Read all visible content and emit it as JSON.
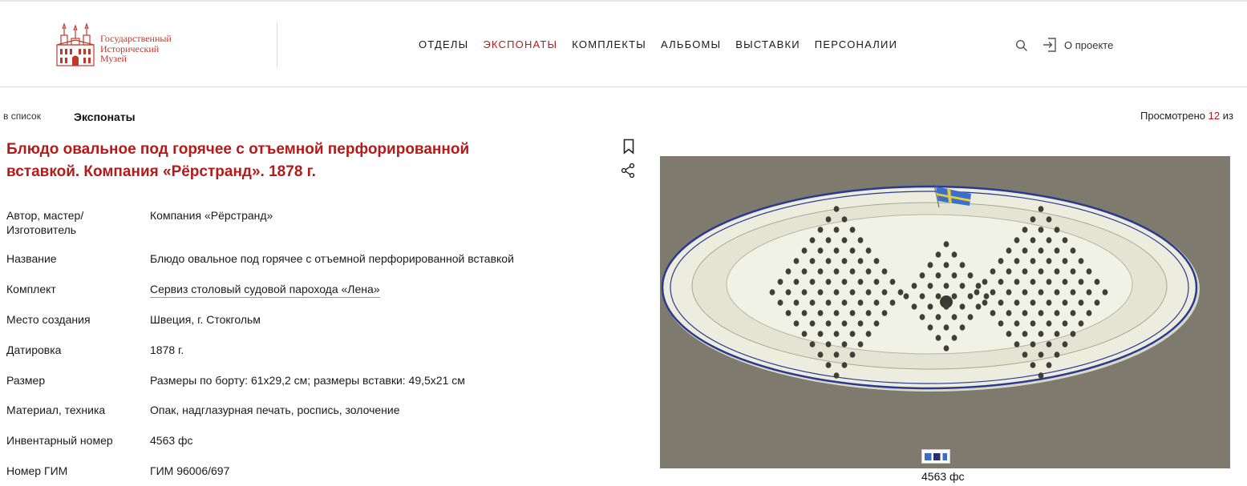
{
  "brand": {
    "line1": "Государственный",
    "line2": "Исторический",
    "line3": "Музей",
    "color": "#c0392b"
  },
  "nav": {
    "items": [
      {
        "label": "ОТДЕЛЫ"
      },
      {
        "label": "ЭКСПОНАТЫ",
        "active": true
      },
      {
        "label": "КОМПЛЕКТЫ"
      },
      {
        "label": "АЛЬБОМЫ"
      },
      {
        "label": "ВЫСТАВКИ"
      },
      {
        "label": "ПЕРСОНАЛИИ"
      }
    ],
    "active_color": "#b31b1b"
  },
  "header_tools": {
    "search_icon": "search-icon",
    "login_icon": "login-icon",
    "about_label": "О проекте"
  },
  "breadcrumb": {
    "back_label": "в список",
    "section_label": "Экспонаты"
  },
  "viewed": {
    "prefix": "Просмотрено ",
    "count": "12",
    "suffix": " из"
  },
  "exhibit": {
    "title": "Блюдо овальное под горячее с отъемной перфорированной вставкой. Компания «Рёрстранд». 1878 г.",
    "properties": [
      {
        "label": "Автор, мастер/ Изготовитель",
        "value": "Компания «Рёрстранд»"
      },
      {
        "label": "Название",
        "value": "Блюдо овальное под горячее с отъемной перфорированной вставкой"
      },
      {
        "label": "Комплект",
        "value": "Сервиз столовый судовой парохода «Лена»"
      },
      {
        "label": "Место создания",
        "value": "Швеция, г. Стокгольм"
      },
      {
        "label": "Датировка",
        "value": "1878 г."
      },
      {
        "label": "Размер",
        "value": "Размеры по борту: 61х29,2 см; размеры вставки: 49,5х21 см"
      },
      {
        "label": "Материал, техника",
        "value": "Опак, надглазурная печать, роспись, золочение"
      },
      {
        "label": "Инвентарный номер",
        "value": "4563 фс"
      },
      {
        "label": "Номер ГИМ",
        "value": "ГИМ 96006/697"
      }
    ],
    "image_caption": "4563 фс"
  }
}
